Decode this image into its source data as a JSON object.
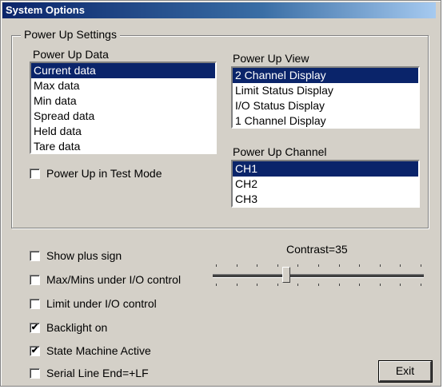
{
  "window": {
    "title": "System Options"
  },
  "power_up_settings": {
    "group_label": "Power Up Settings",
    "data": {
      "label": "Power Up Data",
      "items": [
        "Current data",
        "Max data",
        "Min data",
        "Spread data",
        "Held data",
        "Tare data"
      ],
      "selected": "Current data"
    },
    "view": {
      "label": "Power Up View",
      "items": [
        "2 Channel Display",
        "Limit Status Display",
        "I/O Status Display",
        "1 Channel Display"
      ],
      "selected": "2 Channel Display"
    },
    "channel": {
      "label": "Power Up Channel",
      "items": [
        "CH1",
        "CH2",
        "CH3"
      ],
      "selected": "CH1"
    },
    "test_mode": {
      "label": "Power Up in Test Mode",
      "checked": false
    }
  },
  "options": [
    {
      "id": "show-plus-sign",
      "label": "Show plus sign",
      "checked": false
    },
    {
      "id": "max-mins-io",
      "label": "Max/Mins under I/O control",
      "checked": false
    },
    {
      "id": "limit-io",
      "label": "Limit under I/O control",
      "checked": false
    },
    {
      "id": "backlight",
      "label": "Backlight on",
      "checked": true
    },
    {
      "id": "state-machine",
      "label": "State Machine Active",
      "checked": true
    },
    {
      "id": "serial-line-end",
      "label": "Serial Line End=+LF",
      "checked": false
    }
  ],
  "contrast": {
    "label": "Contrast=35",
    "value": 35
  },
  "exit_button": {
    "label": "Exit"
  },
  "colors": {
    "selection": "#0a246a",
    "face": "#d4d0c8",
    "title_start": "#0a246a",
    "title_end": "#a6caf0"
  }
}
